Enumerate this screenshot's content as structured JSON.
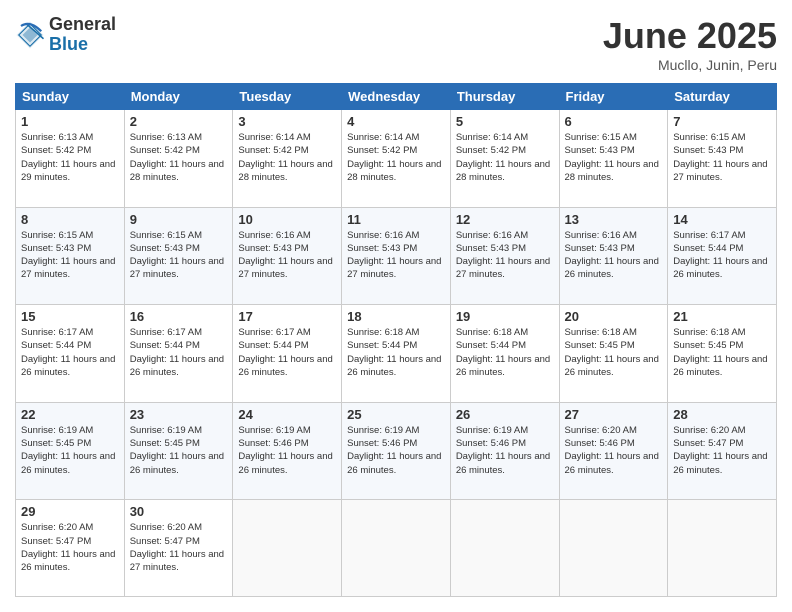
{
  "logo": {
    "general": "General",
    "blue": "Blue"
  },
  "title": "June 2025",
  "location": "Mucllo, Junin, Peru",
  "days_of_week": [
    "Sunday",
    "Monday",
    "Tuesday",
    "Wednesday",
    "Thursday",
    "Friday",
    "Saturday"
  ],
  "weeks": [
    [
      {
        "day": "1",
        "sunrise": "6:13 AM",
        "sunset": "5:42 PM",
        "daylight": "11 hours and 29 minutes."
      },
      {
        "day": "2",
        "sunrise": "6:13 AM",
        "sunset": "5:42 PM",
        "daylight": "11 hours and 28 minutes."
      },
      {
        "day": "3",
        "sunrise": "6:14 AM",
        "sunset": "5:42 PM",
        "daylight": "11 hours and 28 minutes."
      },
      {
        "day": "4",
        "sunrise": "6:14 AM",
        "sunset": "5:42 PM",
        "daylight": "11 hours and 28 minutes."
      },
      {
        "day": "5",
        "sunrise": "6:14 AM",
        "sunset": "5:42 PM",
        "daylight": "11 hours and 28 minutes."
      },
      {
        "day": "6",
        "sunrise": "6:15 AM",
        "sunset": "5:43 PM",
        "daylight": "11 hours and 28 minutes."
      },
      {
        "day": "7",
        "sunrise": "6:15 AM",
        "sunset": "5:43 PM",
        "daylight": "11 hours and 27 minutes."
      }
    ],
    [
      {
        "day": "8",
        "sunrise": "6:15 AM",
        "sunset": "5:43 PM",
        "daylight": "11 hours and 27 minutes."
      },
      {
        "day": "9",
        "sunrise": "6:15 AM",
        "sunset": "5:43 PM",
        "daylight": "11 hours and 27 minutes."
      },
      {
        "day": "10",
        "sunrise": "6:16 AM",
        "sunset": "5:43 PM",
        "daylight": "11 hours and 27 minutes."
      },
      {
        "day": "11",
        "sunrise": "6:16 AM",
        "sunset": "5:43 PM",
        "daylight": "11 hours and 27 minutes."
      },
      {
        "day": "12",
        "sunrise": "6:16 AM",
        "sunset": "5:43 PM",
        "daylight": "11 hours and 27 minutes."
      },
      {
        "day": "13",
        "sunrise": "6:16 AM",
        "sunset": "5:43 PM",
        "daylight": "11 hours and 26 minutes."
      },
      {
        "day": "14",
        "sunrise": "6:17 AM",
        "sunset": "5:44 PM",
        "daylight": "11 hours and 26 minutes."
      }
    ],
    [
      {
        "day": "15",
        "sunrise": "6:17 AM",
        "sunset": "5:44 PM",
        "daylight": "11 hours and 26 minutes."
      },
      {
        "day": "16",
        "sunrise": "6:17 AM",
        "sunset": "5:44 PM",
        "daylight": "11 hours and 26 minutes."
      },
      {
        "day": "17",
        "sunrise": "6:17 AM",
        "sunset": "5:44 PM",
        "daylight": "11 hours and 26 minutes."
      },
      {
        "day": "18",
        "sunrise": "6:18 AM",
        "sunset": "5:44 PM",
        "daylight": "11 hours and 26 minutes."
      },
      {
        "day": "19",
        "sunrise": "6:18 AM",
        "sunset": "5:44 PM",
        "daylight": "11 hours and 26 minutes."
      },
      {
        "day": "20",
        "sunrise": "6:18 AM",
        "sunset": "5:45 PM",
        "daylight": "11 hours and 26 minutes."
      },
      {
        "day": "21",
        "sunrise": "6:18 AM",
        "sunset": "5:45 PM",
        "daylight": "11 hours and 26 minutes."
      }
    ],
    [
      {
        "day": "22",
        "sunrise": "6:19 AM",
        "sunset": "5:45 PM",
        "daylight": "11 hours and 26 minutes."
      },
      {
        "day": "23",
        "sunrise": "6:19 AM",
        "sunset": "5:45 PM",
        "daylight": "11 hours and 26 minutes."
      },
      {
        "day": "24",
        "sunrise": "6:19 AM",
        "sunset": "5:46 PM",
        "daylight": "11 hours and 26 minutes."
      },
      {
        "day": "25",
        "sunrise": "6:19 AM",
        "sunset": "5:46 PM",
        "daylight": "11 hours and 26 minutes."
      },
      {
        "day": "26",
        "sunrise": "6:19 AM",
        "sunset": "5:46 PM",
        "daylight": "11 hours and 26 minutes."
      },
      {
        "day": "27",
        "sunrise": "6:20 AM",
        "sunset": "5:46 PM",
        "daylight": "11 hours and 26 minutes."
      },
      {
        "day": "28",
        "sunrise": "6:20 AM",
        "sunset": "5:47 PM",
        "daylight": "11 hours and 26 minutes."
      }
    ],
    [
      {
        "day": "29",
        "sunrise": "6:20 AM",
        "sunset": "5:47 PM",
        "daylight": "11 hours and 26 minutes."
      },
      {
        "day": "30",
        "sunrise": "6:20 AM",
        "sunset": "5:47 PM",
        "daylight": "11 hours and 27 minutes."
      },
      null,
      null,
      null,
      null,
      null
    ]
  ]
}
